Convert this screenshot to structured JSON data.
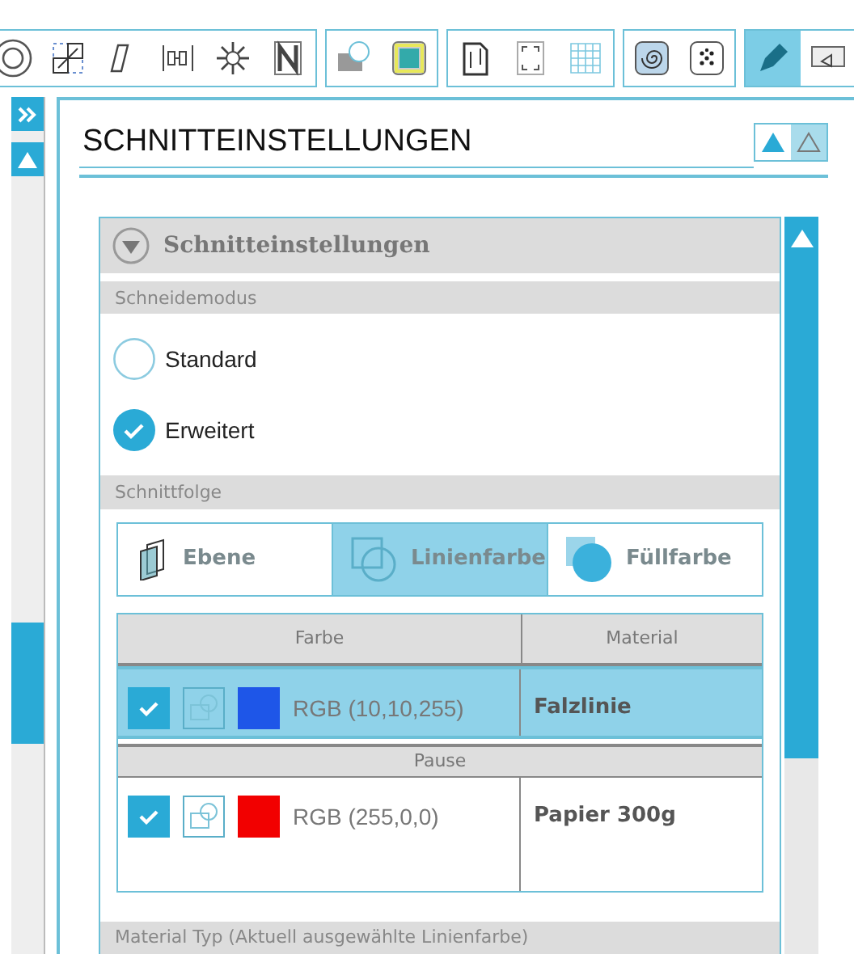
{
  "toolbar": {
    "groups": [
      {
        "icons": [
          {
            "kind": "ring",
            "selected": false
          },
          {
            "kind": "resize",
            "selected": false
          },
          {
            "kind": "slant",
            "selected": false
          },
          {
            "kind": "align",
            "selected": false
          },
          {
            "kind": "flower",
            "selected": false
          },
          {
            "kind": "letter",
            "selected": false
          }
        ]
      },
      {
        "icons": [
          {
            "kind": "media",
            "selected": false
          },
          {
            "kind": "frame",
            "selected": false
          }
        ]
      },
      {
        "icons": [
          {
            "kind": "page",
            "selected": false
          },
          {
            "kind": "corners",
            "selected": false
          },
          {
            "kind": "grid",
            "selected": false
          }
        ]
      },
      {
        "icons": [
          {
            "kind": "spiral",
            "selected": false
          },
          {
            "kind": "dots",
            "selected": false
          }
        ]
      },
      {
        "icons": [
          {
            "kind": "blade",
            "selected": true
          },
          {
            "kind": "cutter",
            "selected": false
          }
        ]
      }
    ]
  },
  "panel": {
    "title": "SCHNITTEINSTELLUNGEN",
    "section": {
      "title": "Schnitteinstellungen",
      "expanded": true,
      "cut_mode": {
        "label": "Schneidemodus",
        "options": [
          {
            "label": "Standard",
            "selected": false
          },
          {
            "label": "Erweitert",
            "selected": true
          }
        ]
      },
      "cut_order": {
        "label": "Schnittfolge",
        "tabs": [
          {
            "label": "Ebene",
            "kind": "layer",
            "selected": false
          },
          {
            "label": "Linienfarbe",
            "kind": "line",
            "selected": true
          },
          {
            "label": "Füllfarbe",
            "kind": "fill",
            "selected": false
          }
        ]
      },
      "table": {
        "columns": [
          "Farbe",
          "Material"
        ],
        "rows": [
          {
            "kind": "color",
            "checked": true,
            "selected": true,
            "color": "#1e56e8",
            "rgb": "RGB (10,10,255)",
            "material": "Falzlinie"
          },
          {
            "kind": "pause",
            "label": "Pause"
          },
          {
            "kind": "color",
            "checked": true,
            "selected": false,
            "color": "#f20000",
            "rgb": "RGB (255,0,0)",
            "material": "Papier 300g"
          }
        ]
      },
      "material_type": {
        "label": "Material Typ (Aktuell ausgewählte Linienfarbe)"
      }
    }
  }
}
